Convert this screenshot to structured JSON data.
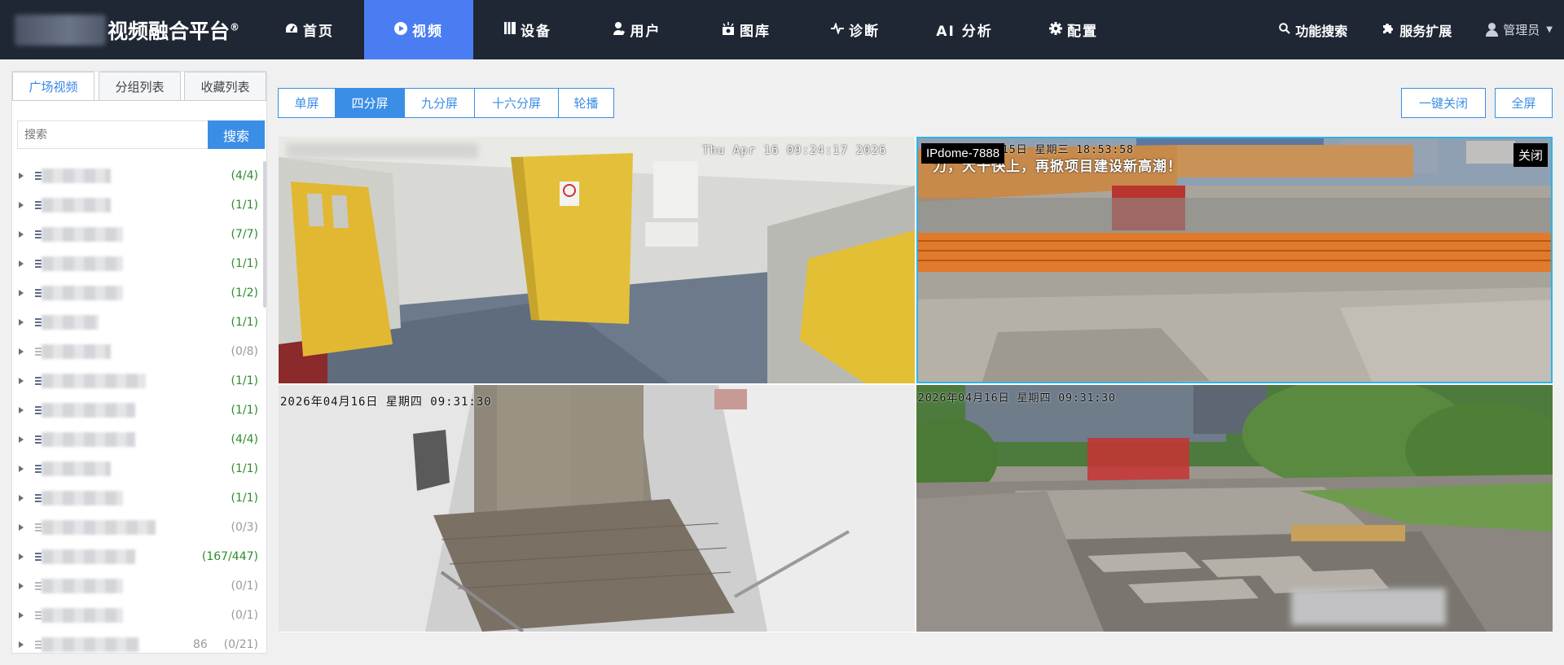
{
  "header": {
    "logo_text": "视频融合平台",
    "logo_mark": "®",
    "nav": [
      {
        "label": "首页",
        "icon": "dashboard-icon"
      },
      {
        "label": "视频",
        "icon": "play-circle-icon"
      },
      {
        "label": "设备",
        "icon": "device-icon"
      },
      {
        "label": "用户",
        "icon": "user-icon"
      },
      {
        "label": "图库",
        "icon": "gallery-icon"
      },
      {
        "label": "诊断",
        "icon": "pulse-icon"
      },
      {
        "label": "AI 分析",
        "icon": ""
      },
      {
        "label": "配置",
        "icon": "gear-icon"
      }
    ],
    "active_nav": "视频",
    "right": {
      "search_label": "功能搜索",
      "extend_label": "服务扩展",
      "user_label": "管理员"
    },
    "accent_color": "#4b7df2"
  },
  "sidebar": {
    "tabs": [
      "广场视频",
      "分组列表",
      "收藏列表"
    ],
    "active_tab": "广场视频",
    "search_placeholder": "搜索",
    "search_button": "搜索",
    "tree": [
      {
        "count": "(4/4)",
        "online": true
      },
      {
        "count": "(1/1)",
        "online": true
      },
      {
        "count": "(7/7)",
        "online": true
      },
      {
        "count": "(1/1)",
        "online": true
      },
      {
        "count": "(1/2)",
        "online": true
      },
      {
        "count": "(1/1)",
        "online": true
      },
      {
        "count": "(0/8)",
        "online": false
      },
      {
        "count": "(1/1)",
        "online": true
      },
      {
        "count": "(1/1)",
        "online": true
      },
      {
        "count": "(4/4)",
        "online": true
      },
      {
        "count": "(1/1)",
        "online": true
      },
      {
        "count": "(1/1)",
        "online": true
      },
      {
        "count": "(0/3)",
        "online": false
      },
      {
        "count": "(167/447)",
        "online": true
      },
      {
        "count": "(0/1)",
        "online": false
      },
      {
        "count": "(0/1)",
        "online": false
      },
      {
        "count": "(0/21)",
        "online": false,
        "suffix": "86"
      }
    ]
  },
  "toolbar": {
    "layouts": [
      "单屏",
      "四分屏",
      "九分屏",
      "十六分屏",
      "轮播"
    ],
    "active_layout": "四分屏",
    "close_all": "一键关闭",
    "fullscreen": "全屏"
  },
  "videos": [
    {
      "osd": "Thu Apr 16 09:24:17 2026"
    },
    {
      "label": "IPdome-7888",
      "osd": "15日  星期三  18:53:58",
      "banner": "力，大干快上，再掀项目建设新高潮！",
      "close": "关闭"
    },
    {
      "osd": "2026年04月16日  星期四  09:31:30"
    },
    {
      "osd": "2026年04月16日  星期四  09:31:30"
    }
  ]
}
